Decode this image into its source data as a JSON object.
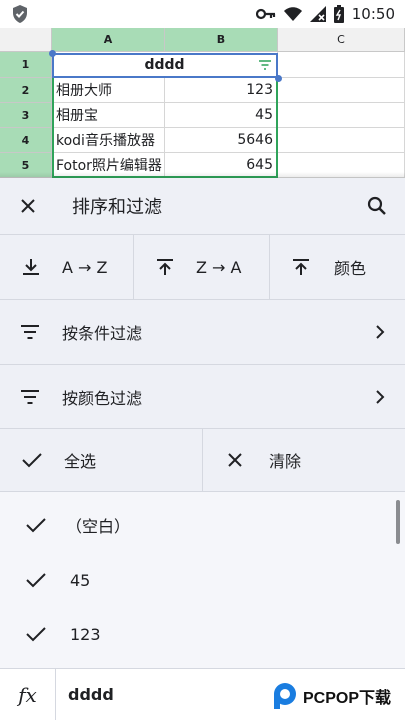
{
  "status_bar": {
    "time": "10:50"
  },
  "sheet": {
    "columns": [
      "A",
      "B",
      "C"
    ],
    "rows": [
      {
        "num": "1",
        "a": "dddd",
        "b": ""
      },
      {
        "num": "2",
        "a": "相册大师",
        "b": "123"
      },
      {
        "num": "3",
        "a": "相册宝",
        "b": "45"
      },
      {
        "num": "4",
        "a": "kodi音乐播放器",
        "b": "5646"
      },
      {
        "num": "5",
        "a": "Fotor照片编辑器",
        "b": "645"
      }
    ]
  },
  "panel": {
    "title": "排序和过滤",
    "sort": {
      "az": "A → Z",
      "za": "Z → A",
      "color": "颜色"
    },
    "filter_condition": "按条件过滤",
    "filter_color": "按颜色过滤",
    "select_all": "全选",
    "clear": "清除",
    "values": [
      "（空白）",
      "45",
      "123"
    ]
  },
  "formula_bar": {
    "fx": "fx",
    "value": "dddd"
  },
  "watermark": {
    "text": "PCPOP下载"
  },
  "colors": {
    "accent_green": "#2fa35a",
    "header_select": "#a8dcb6",
    "filter_blue": "#4a78c8"
  }
}
